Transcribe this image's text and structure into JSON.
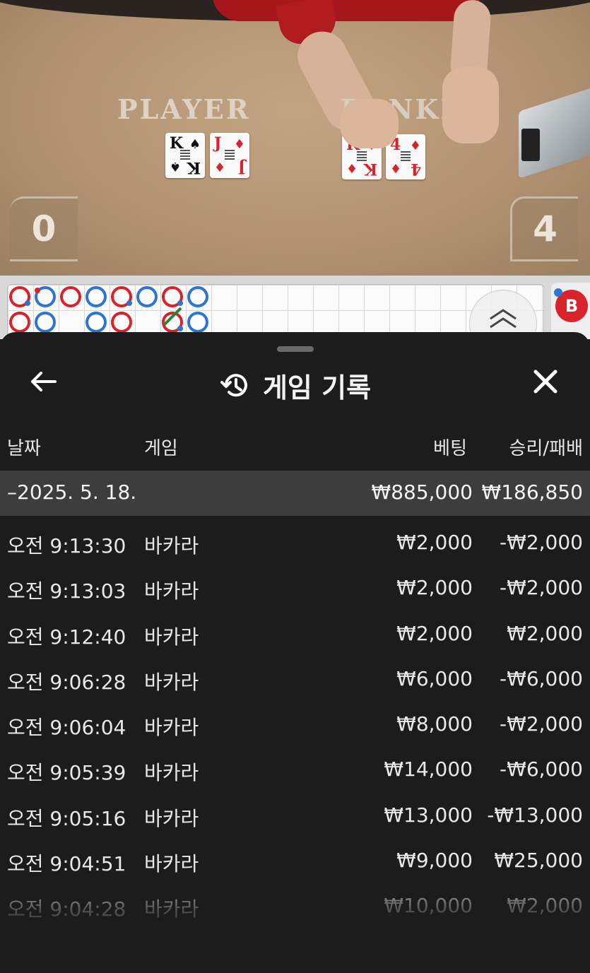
{
  "table": {
    "player_label": "PLAYER",
    "banker_label": "BANKER",
    "player_score": "0",
    "banker_score": "4",
    "player_cards": [
      {
        "rank": "K",
        "suit": "♠",
        "color": "black"
      },
      {
        "rank": "J",
        "suit": "♦",
        "color": "red"
      }
    ],
    "banker_cards": [
      {
        "rank": "K",
        "suit": "♦",
        "color": "red"
      },
      {
        "rank": "4",
        "suit": "♦",
        "color": "red"
      }
    ]
  },
  "road": {
    "side_badge": "B",
    "colors": {
      "banker": "#d8232a",
      "player": "#2e74d4",
      "tie": "#1f8a33"
    }
  },
  "sheet": {
    "title": "게임 기록",
    "icons": {
      "back": "arrow-left-icon",
      "history": "history-icon",
      "close": "close-icon"
    },
    "columns": {
      "date": "날짜",
      "game": "게임",
      "bet": "베팅",
      "result": "승리/패배"
    },
    "summary": {
      "date": "–2025. 5. 18.",
      "bet": "₩885,000",
      "result": "₩186,850"
    },
    "rows": [
      {
        "time": "오전 9:13:30",
        "game": "바카라",
        "bet": "₩2,000",
        "result": "-₩2,000"
      },
      {
        "time": "오전 9:13:03",
        "game": "바카라",
        "bet": "₩2,000",
        "result": "-₩2,000"
      },
      {
        "time": "오전 9:12:40",
        "game": "바카라",
        "bet": "₩2,000",
        "result": "₩2,000"
      },
      {
        "time": "오전 9:06:28",
        "game": "바카라",
        "bet": "₩6,000",
        "result": "-₩6,000"
      },
      {
        "time": "오전 9:06:04",
        "game": "바카라",
        "bet": "₩8,000",
        "result": "-₩2,000"
      },
      {
        "time": "오전 9:05:39",
        "game": "바카라",
        "bet": "₩14,000",
        "result": "-₩6,000"
      },
      {
        "time": "오전 9:05:16",
        "game": "바카라",
        "bet": "₩13,000",
        "result": "-₩13,000"
      },
      {
        "time": "오전 9:04:51",
        "game": "바카라",
        "bet": "₩9,000",
        "result": "₩25,000"
      },
      {
        "time": "오전 9:04:28",
        "game": "바카라",
        "bet": "₩10,000",
        "result": "₩2,000"
      }
    ]
  }
}
